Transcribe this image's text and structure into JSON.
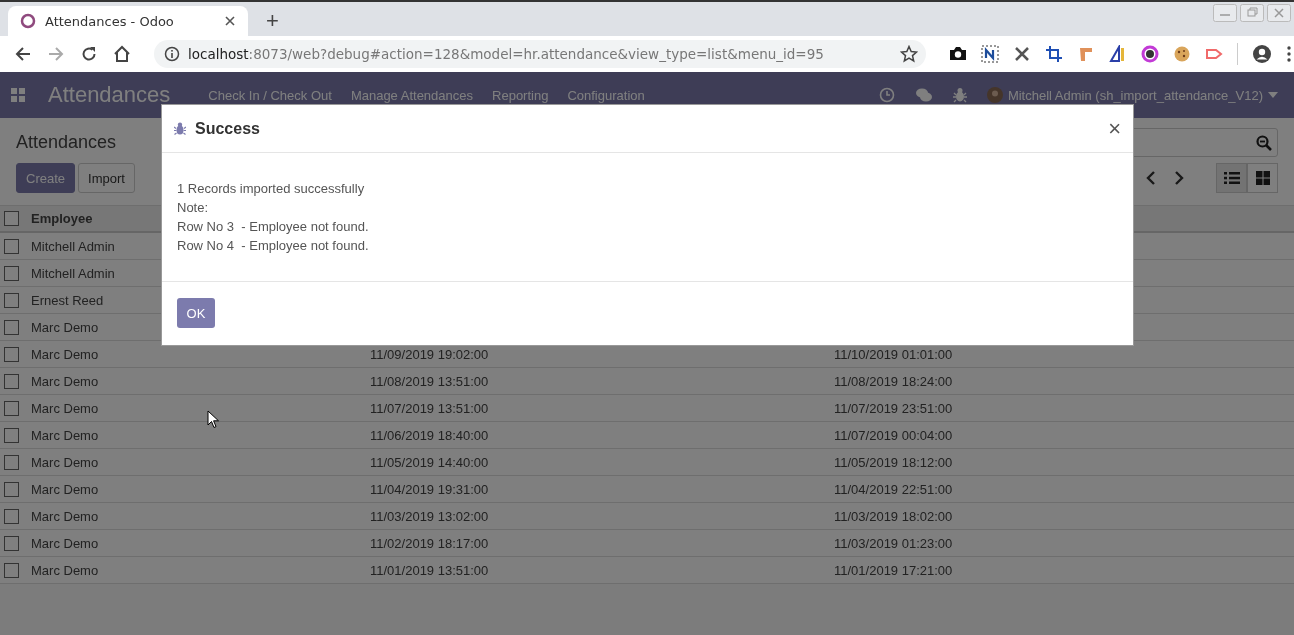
{
  "browser": {
    "tab_title": "Attendances - Odoo",
    "new_tab": "+",
    "url_host": "localhost",
    "url_path": ":8073/web?debug#action=128&model=hr.attendance&view_type=list&menu_id=95"
  },
  "navbar": {
    "brand": "Attendances",
    "menus": [
      "Check In / Check Out",
      "Manage Attendances",
      "Reporting",
      "Configuration"
    ],
    "user": "Mitchell Admin (sh_import_attendance_V12)"
  },
  "control_panel": {
    "title": "Attendances",
    "buttons": [
      {
        "label": "Create",
        "kind": "primary"
      },
      {
        "label": "Import",
        "kind": "secondary"
      }
    ],
    "views": [
      {
        "kind": "list",
        "selected": true
      },
      {
        "kind": "kanban",
        "selected": false
      }
    ]
  },
  "table": {
    "select_all": {
      "checked": false
    },
    "columns": [
      "Employee"
    ],
    "rows": [
      {
        "checked": false,
        "employee": "Mitchell Admin"
      },
      {
        "checked": false,
        "employee": "Mitchell Admin"
      },
      {
        "checked": false,
        "employee": "Ernest Reed"
      },
      {
        "checked": false,
        "employee": "Marc Demo"
      },
      {
        "checked": false,
        "employee": "Marc Demo",
        "column_2": "11/09/2019 19:02:00",
        "column_3": "11/10/2019 01:01:00"
      },
      {
        "checked": false,
        "employee": "Marc Demo",
        "column_2": "11/08/2019 13:51:00",
        "column_3": "11/08/2019 18:24:00"
      },
      {
        "checked": false,
        "employee": "Marc Demo",
        "column_2": "11/07/2019 13:51:00",
        "column_3": "11/07/2019 23:51:00"
      },
      {
        "checked": false,
        "employee": "Marc Demo",
        "column_2": "11/06/2019 18:40:00",
        "column_3": "11/07/2019 00:04:00"
      },
      {
        "checked": false,
        "employee": "Marc Demo",
        "column_2": "11/05/2019 14:40:00",
        "column_3": "11/05/2019 18:12:00"
      },
      {
        "checked": false,
        "employee": "Marc Demo",
        "column_2": "11/04/2019 19:31:00",
        "column_3": "11/04/2019 22:51:00"
      },
      {
        "checked": false,
        "employee": "Marc Demo",
        "column_2": "11/03/2019 13:02:00",
        "column_3": "11/03/2019 18:02:00"
      },
      {
        "checked": false,
        "employee": "Marc Demo",
        "column_2": "11/02/2019 18:17:00",
        "column_3": "11/03/2019 01:23:00"
      },
      {
        "checked": false,
        "employee": "Marc Demo",
        "column_2": "11/01/2019 13:51:00",
        "column_3": "11/01/2019 17:21:00"
      }
    ]
  },
  "dialog": {
    "title": "Success",
    "close": "×",
    "lines": [
      "1 Records imported successfully",
      "Note:",
      "Row No 3  - Employee not found.",
      "Row No 4  - Employee not found."
    ],
    "button": "OK"
  }
}
